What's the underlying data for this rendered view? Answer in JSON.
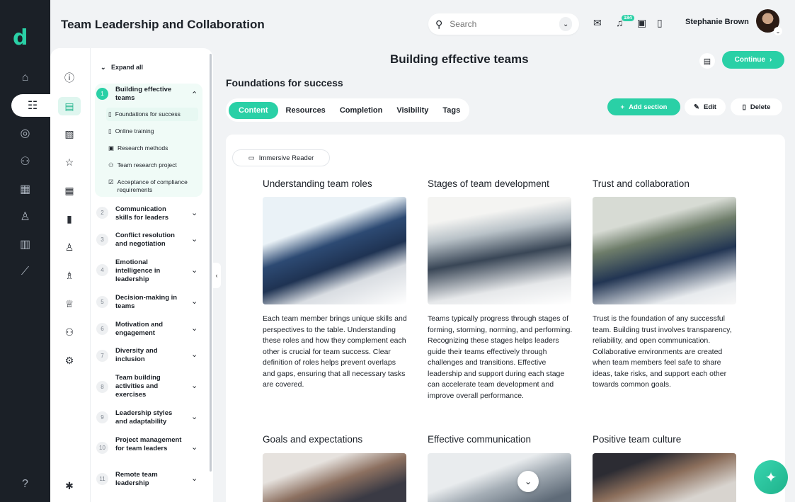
{
  "app": {
    "title": "Team Leadership and Collaboration",
    "brand_color": "#2ad0a6"
  },
  "header": {
    "search_placeholder": "Search",
    "notification_count": "184",
    "user_name": "Stephanie Brown"
  },
  "toc": {
    "expand_all": "Expand all",
    "modules": [
      {
        "num": "1",
        "title": "Building effective teams",
        "expanded": true,
        "lessons": [
          "Foundations for success",
          "Online training",
          "Research methods",
          "Team research project",
          "Acceptance of compliance requirements"
        ]
      },
      {
        "num": "2",
        "title": "Communication skills for leaders"
      },
      {
        "num": "3",
        "title": "Conflict resolution and negotiation"
      },
      {
        "num": "4",
        "title": "Emotional intelligence in leadership"
      },
      {
        "num": "5",
        "title": "Decision-making in teams"
      },
      {
        "num": "6",
        "title": "Motivation and engagement"
      },
      {
        "num": "7",
        "title": "Diversity and inclusion"
      },
      {
        "num": "8",
        "title": "Team building activities and exercises"
      },
      {
        "num": "9",
        "title": "Leadership styles and adaptability"
      },
      {
        "num": "10",
        "title": "Project management for team leaders"
      },
      {
        "num": "11",
        "title": "Remote team leadership"
      }
    ]
  },
  "main": {
    "title": "Building effective teams",
    "continue_label": "Continue",
    "section_title": "Foundations for success",
    "tabs": [
      "Content",
      "Resources",
      "Completion",
      "Visibility",
      "Tags"
    ],
    "add_section_label": "Add section",
    "edit_label": "Edit",
    "delete_label": "Delete",
    "immersive_reader_label": "Immersive Reader",
    "cards": [
      {
        "title": "Understanding team roles",
        "text": "Each team member brings unique skills and perspectives to the table. Understanding these roles and how they complement each other is crucial for team success. Clear definition of roles helps prevent overlaps and gaps, ensuring that all necessary tasks are covered."
      },
      {
        "title": "Stages of team development",
        "text": "Teams typically progress through stages of forming, storming, norming, and performing. Recognizing these stages helps leaders guide their teams effectively through challenges and transitions. Effective leadership and support during each stage can accelerate team development and improve overall performance."
      },
      {
        "title": "Trust and collaboration",
        "text": "Trust is the foundation of any successful team. Building trust involves transparency, reliability, and open communication. Collaborative environments are created when team members feel safe to share ideas, take risks, and support each other towards common goals."
      },
      {
        "title": "Goals and expectations",
        "text": ""
      },
      {
        "title": "Effective communication",
        "text": ""
      },
      {
        "title": "Positive team culture",
        "text": ""
      }
    ]
  }
}
